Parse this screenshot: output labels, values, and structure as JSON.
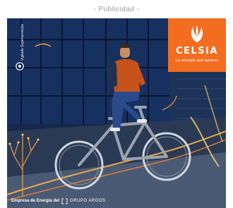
{
  "ad_label": "- Publicidad -",
  "brand": {
    "name": "CELSIA",
    "tagline": "La energía que quieres",
    "box_color": "#f36d21",
    "icon": "celsia-flame-logo"
  },
  "regulator": {
    "text": "Vigilado Superservicios"
  },
  "footer": {
    "empresa_text": "Empresa de Energía del",
    "group_name": "GRUPO ARGOS",
    "group_icon": "grupo-argos-bracket-icon"
  }
}
